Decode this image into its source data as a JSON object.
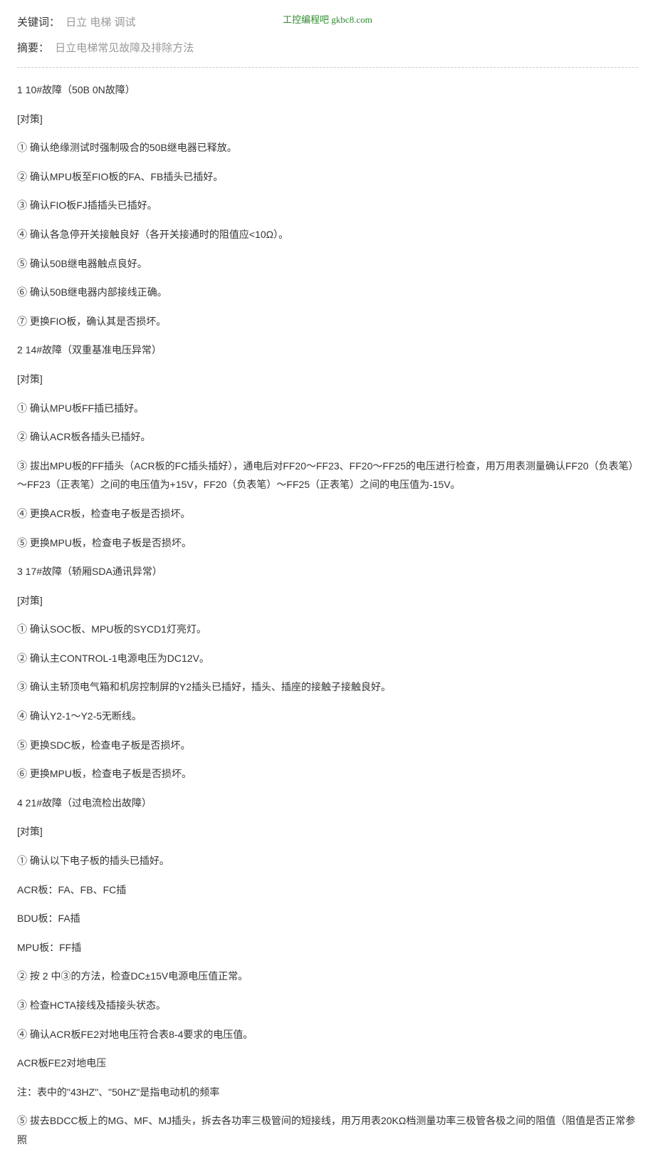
{
  "watermark": "工控编程吧 gkbc8.com",
  "meta": {
    "keywords_label": "关键词：",
    "keywords_value": "日立 电梯 调试",
    "abstract_label": "摘要：",
    "abstract_value": "日立电梯常见故障及排除方法"
  },
  "lines": [
    "1 10#故障（50B 0N故障）",
    "[对策]",
    "① 确认绝缘测试时强制吸合的50B继电器已释放。",
    "② 确认MPU板至FIO板的FA、FB插头已插好。",
    "③ 确认FIO板FJ插插头已插好。",
    "④ 确认各急停开关接触良好（各开关接通时的阻值应<10Ω）。",
    "⑤ 确认50B继电器触点良好。",
    "⑥ 确认50B继电器内部接线正确。",
    "⑦ 更换FIO板，确认其是否损坏。",
    "2 14#故障（双重基准电压异常）",
    "[对策]",
    "① 确认MPU板FF插已插好。",
    "② 确认ACR板各插头已插好。",
    "③ 拔出MPU板的FF插头（ACR板的FC插头插好），通电后对FF20～FF23、FF20～FF25的电压进行检查，用万用表测量确认FF20（负表笔）～FF23（正表笔）之间的电压值为+15V，FF20（负表笔）～FF25（正表笔）之间的电压值为-15V。",
    "④ 更换ACR板，检查电子板是否损坏。",
    "⑤ 更换MPU板，检查电子板是否损坏。",
    "3 17#故障（轿厢SDA通讯异常）",
    "[对策]",
    "① 确认SOC板、MPU板的SYCD1灯亮灯。",
    "② 确认主CONTROL-1电源电压为DC12V。",
    "③ 确认主轿顶电气箱和机房控制屏的Y2插头已插好，插头、插座的接触子接触良好。",
    "④ 确认Y2-1～Y2-5无断线。",
    "⑤ 更换SDC板，检查电子板是否损坏。",
    "⑥ 更换MPU板，检查电子板是否损坏。",
    "4 21#故障（过电流检出故障）",
    "[对策]",
    "① 确认以下电子板的插头已插好。",
    "ACR板：FA、FB、FC插",
    "BDU板：FA插",
    "MPU板：FF插",
    "② 按 2 中③的方法，检查DC±15V电源电压值正常。",
    "③ 检查HCTA接线及插接头状态。",
    "④ 确认ACR板FE2对地电压符合表8-4要求的电压值。",
    "ACR板FE2对地电压",
    "注：表中的\"43HZ\"、\"50HZ\"是指电动机的频率",
    "⑤ 拔去BDCC板上的MG、MF、MJ插头，拆去各功率三极管间的短接线，用万用表20KΩ档测量功率三极管各极之间的阻值（阻值是否正常参照"
  ]
}
